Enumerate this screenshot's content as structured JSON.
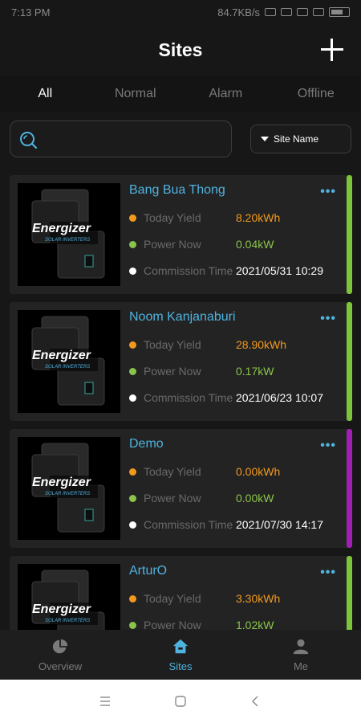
{
  "status_bar": {
    "time": "7:13 PM",
    "net_speed": "84.7KB/s"
  },
  "header": {
    "title": "Sites"
  },
  "tabs": [
    {
      "label": "All",
      "active": true
    },
    {
      "label": "Normal",
      "active": false
    },
    {
      "label": "Alarm",
      "active": false
    },
    {
      "label": "Offline",
      "active": false
    }
  ],
  "search": {
    "placeholder": ""
  },
  "sort": {
    "selected": "Site Name"
  },
  "labels": {
    "today_yield": "Today Yield",
    "power_now": "Power Now",
    "commission_time": "Commission Time"
  },
  "colors": {
    "yield": "#f39a1e",
    "power": "#8ac44b",
    "commission": "#ffffff",
    "accent_green": "#7cc43a",
    "accent_purple": "#a21fb5",
    "link": "#4fb3e0"
  },
  "thumb": {
    "brand": "Energizer",
    "sub": "SOLAR INVERTERS"
  },
  "sites": [
    {
      "name": "Bang Bua Thong",
      "today_yield": "8.20kWh",
      "power_now": "0.04kW",
      "commission_time": "2021/05/31 10:29",
      "status_color": "#7cc43a"
    },
    {
      "name": "Noom Kanjanaburi",
      "today_yield": "28.90kWh",
      "power_now": "0.17kW",
      "commission_time": "2021/06/23 10:07",
      "status_color": "#7cc43a"
    },
    {
      "name": "Demo",
      "today_yield": "0.00kWh",
      "power_now": "0.00kW",
      "commission_time": "2021/07/30 14:17",
      "status_color": "#a21fb5"
    },
    {
      "name": "ArturO",
      "today_yield": "3.30kWh",
      "power_now": "1.02kW",
      "commission_time": "",
      "status_color": "#7cc43a"
    }
  ],
  "bottom_nav": [
    {
      "label": "Overview",
      "icon": "pie-chart-icon",
      "active": false
    },
    {
      "label": "Sites",
      "icon": "home-icon",
      "active": true
    },
    {
      "label": "Me",
      "icon": "person-icon",
      "active": false
    }
  ]
}
